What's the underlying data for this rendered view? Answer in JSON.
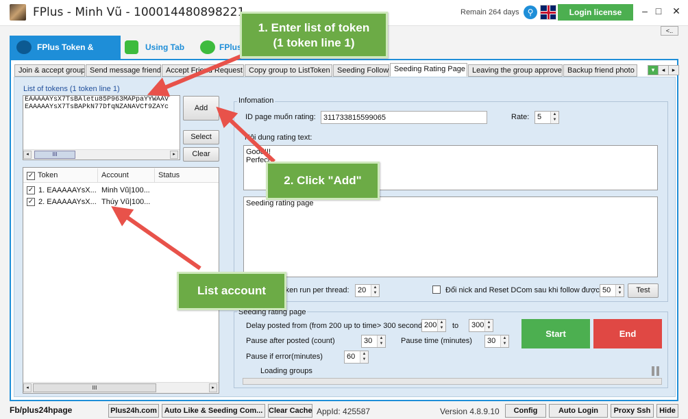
{
  "window": {
    "title": "FPlus - Minh Vũ - 100014480898221",
    "remain": "Remain 264 days",
    "login_license": "Login license",
    "back_label": "<..",
    "minimize": "–",
    "maximize": "□",
    "close": "✕"
  },
  "main_tabs": [
    {
      "label": "FPlus Token & Cookie",
      "active": true
    },
    {
      "label": "Using Tab"
    },
    {
      "label": "FPlus"
    }
  ],
  "sub_tabs": [
    "Join & accept group",
    "Send message friend",
    "Accept Friend Request",
    "Copy group to ListToken",
    "Seeding Follow",
    "Seeding Rating Page",
    "Leaving the group approve",
    "Backup friend photo"
  ],
  "left": {
    "tokens_label": "List of tokens (1 token line 1)",
    "tokens": [
      "EAAAAAYsX7TsBAletu85P963MAPpaYYWAAV",
      "EAAAAAYsX7TsBAPkN77DfqNZANAVCf9ZAYc"
    ],
    "add": "Add",
    "select": "Select",
    "clear": "Clear",
    "columns": [
      "Token",
      "Account",
      "Status"
    ],
    "accounts": [
      {
        "token": "1. EAAAAAYsX...",
        "account": "Minh Vũ|100..."
      },
      {
        "token": "2. EAAAAAYsX...",
        "account": "Thúy Vũ|100..."
      }
    ],
    "scroll_thumb": "III"
  },
  "info": {
    "group_label": "Infomation",
    "id_label": "ID page muốn rating:",
    "id_value": "311733815599065",
    "rate_label": "Rate:",
    "rate_value": "5",
    "content_label": "Nội dung rating text:",
    "content_lines": [
      "Good!!!",
      "Perfect"
    ],
    "seeding_text": "Seeding rating page",
    "token_run_label": "Token run per thread:",
    "token_run_value": "20",
    "reset_label": "Đổi nick and Reset DCom sau khi follow được",
    "reset_value": "50",
    "test": "Test"
  },
  "seeding": {
    "group_label": "Seeding rating page",
    "delay_label": "Delay posted from (from 200 up to time> 300 seconds)",
    "delay_from": "200",
    "to_label": "to",
    "delay_to": "300",
    "pause_after_label": "Pause after posted (count)",
    "pause_after_value": "30",
    "pause_time_label": "Pause time (minutes)",
    "pause_time_value": "30",
    "pause_error_label": "Pause if error(minutes)",
    "pause_error_value": "60",
    "loading": "Loading groups",
    "start": "Start",
    "end": "End"
  },
  "callouts": {
    "step1": [
      "1. Enter list of token",
      "(1 token line 1)"
    ],
    "step2": "2. Click \"Add\"",
    "list": "List account"
  },
  "status": {
    "fb": "Fb/plus24hpage",
    "plus24h": "Plus24h.com",
    "auto_like": "Auto Like & Seeding Com...",
    "clear_cache": "Clear Cache",
    "appid": "AppId: 425587",
    "version": "Version 4.8.9.10",
    "config": "Config",
    "auto_login": "Auto Login",
    "proxy": "Proxy Ssh",
    "hide": "Hide"
  },
  "colors": {
    "accent": "#1e8ed8",
    "green": "#4caf50",
    "red": "#e04844",
    "callout": "#6cab46",
    "arrow": "#e8524a"
  }
}
